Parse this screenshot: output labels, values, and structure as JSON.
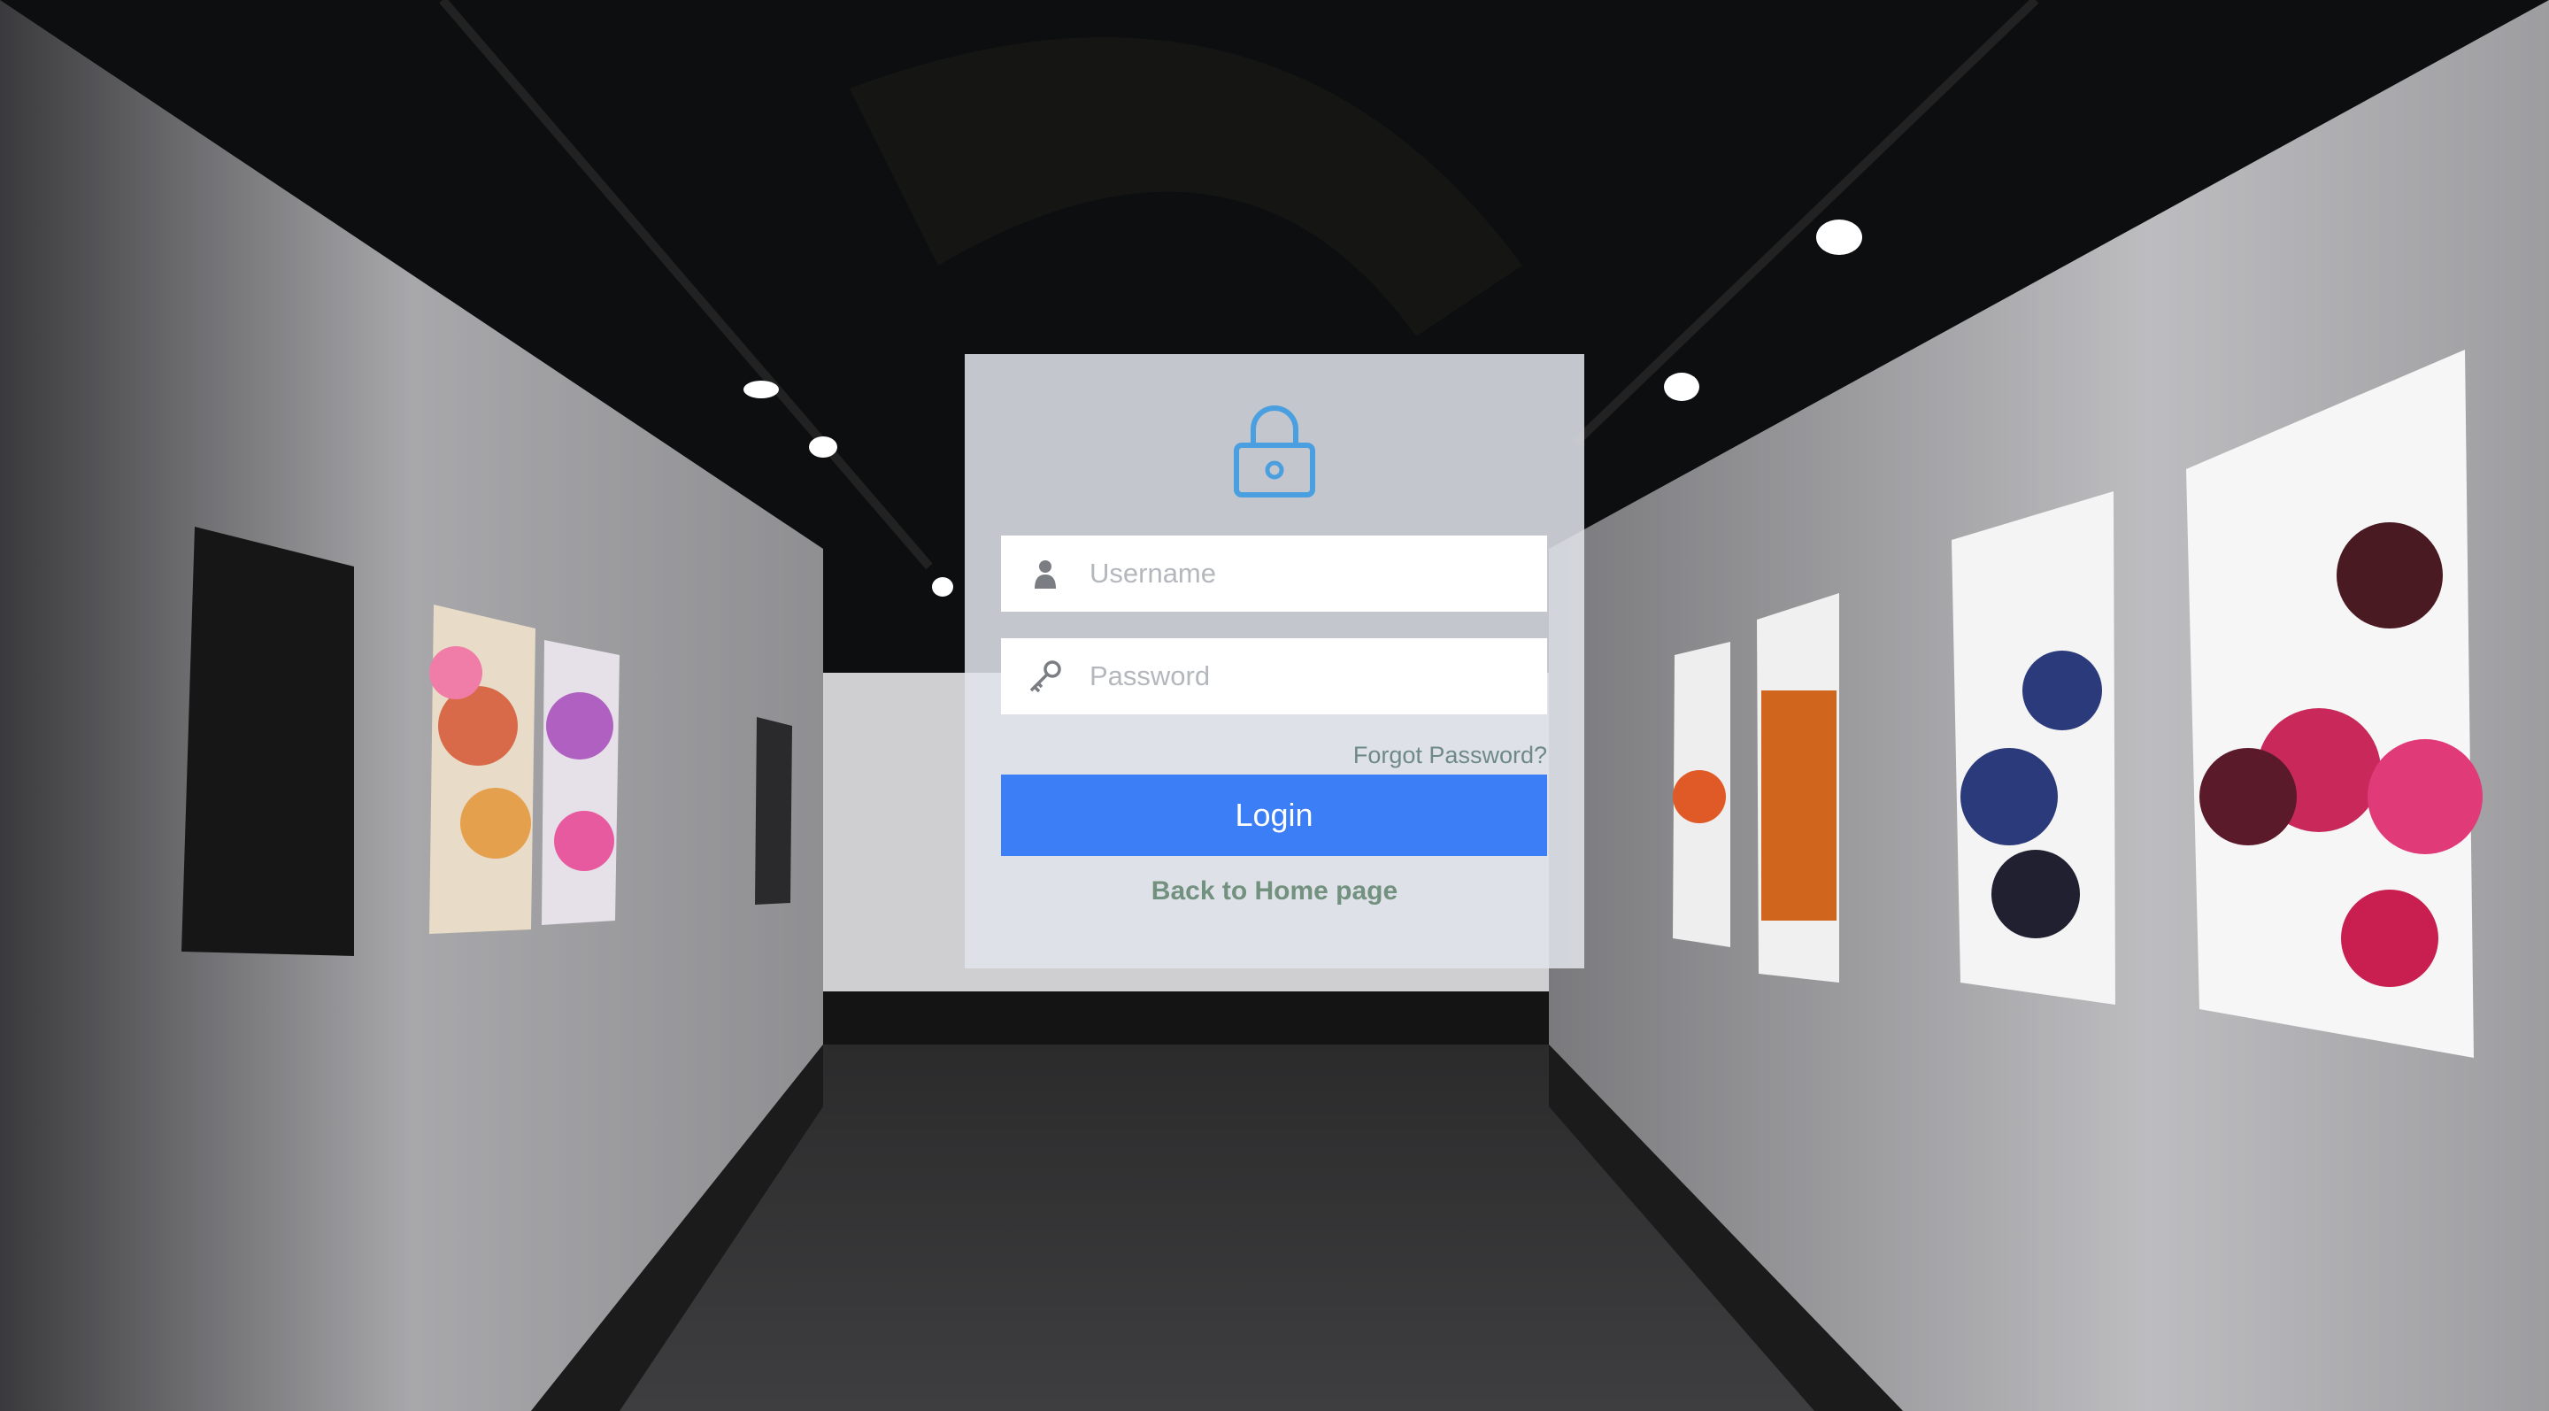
{
  "login": {
    "lock_icon": "lock-icon",
    "username": {
      "icon": "user-icon",
      "placeholder": "Username",
      "value": ""
    },
    "password": {
      "icon": "key-icon",
      "placeholder": "Password",
      "value": ""
    },
    "forgot_password_label": "Forgot Password?",
    "login_button_label": "Login",
    "back_home_label": "Back to Home page"
  },
  "colors": {
    "accent": "#3c7ef5",
    "lock_icon": "#4a9fe0",
    "link": "#6e8a86",
    "card_background": "rgba(226,228,235,0.86)"
  },
  "background": {
    "scene": "art gallery corridor"
  }
}
